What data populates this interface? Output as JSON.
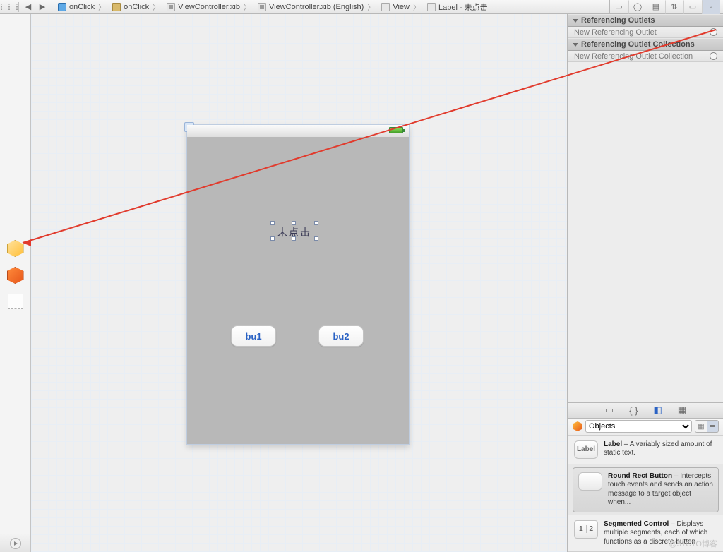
{
  "breadcrumbs": [
    "onClick",
    "onClick",
    "ViewController.xib",
    "ViewController.xib (English)",
    "View",
    "Label - 未点击"
  ],
  "inspector": {
    "section1_title": "Referencing Outlets",
    "section1_row": "New Referencing Outlet",
    "section2_title": "Referencing Outlet Collections",
    "section2_row": "New Referencing Outlet Collection"
  },
  "device": {
    "label_text": "未点击",
    "button1": "bu1",
    "button2": "bu2"
  },
  "library": {
    "filter": "Objects",
    "items": [
      {
        "icon": "Label",
        "title": "Label",
        "desc": " – A variably sized amount of static text."
      },
      {
        "icon": "",
        "title": "Round Rect Button",
        "desc": " – Intercepts touch events and sends an action message to a target object when..."
      },
      {
        "icon": "1|2",
        "title": "Segmented Control",
        "desc": " – Displays multiple segments, each of which functions as a discrete button."
      }
    ]
  },
  "watermark": "@51CTO博客"
}
